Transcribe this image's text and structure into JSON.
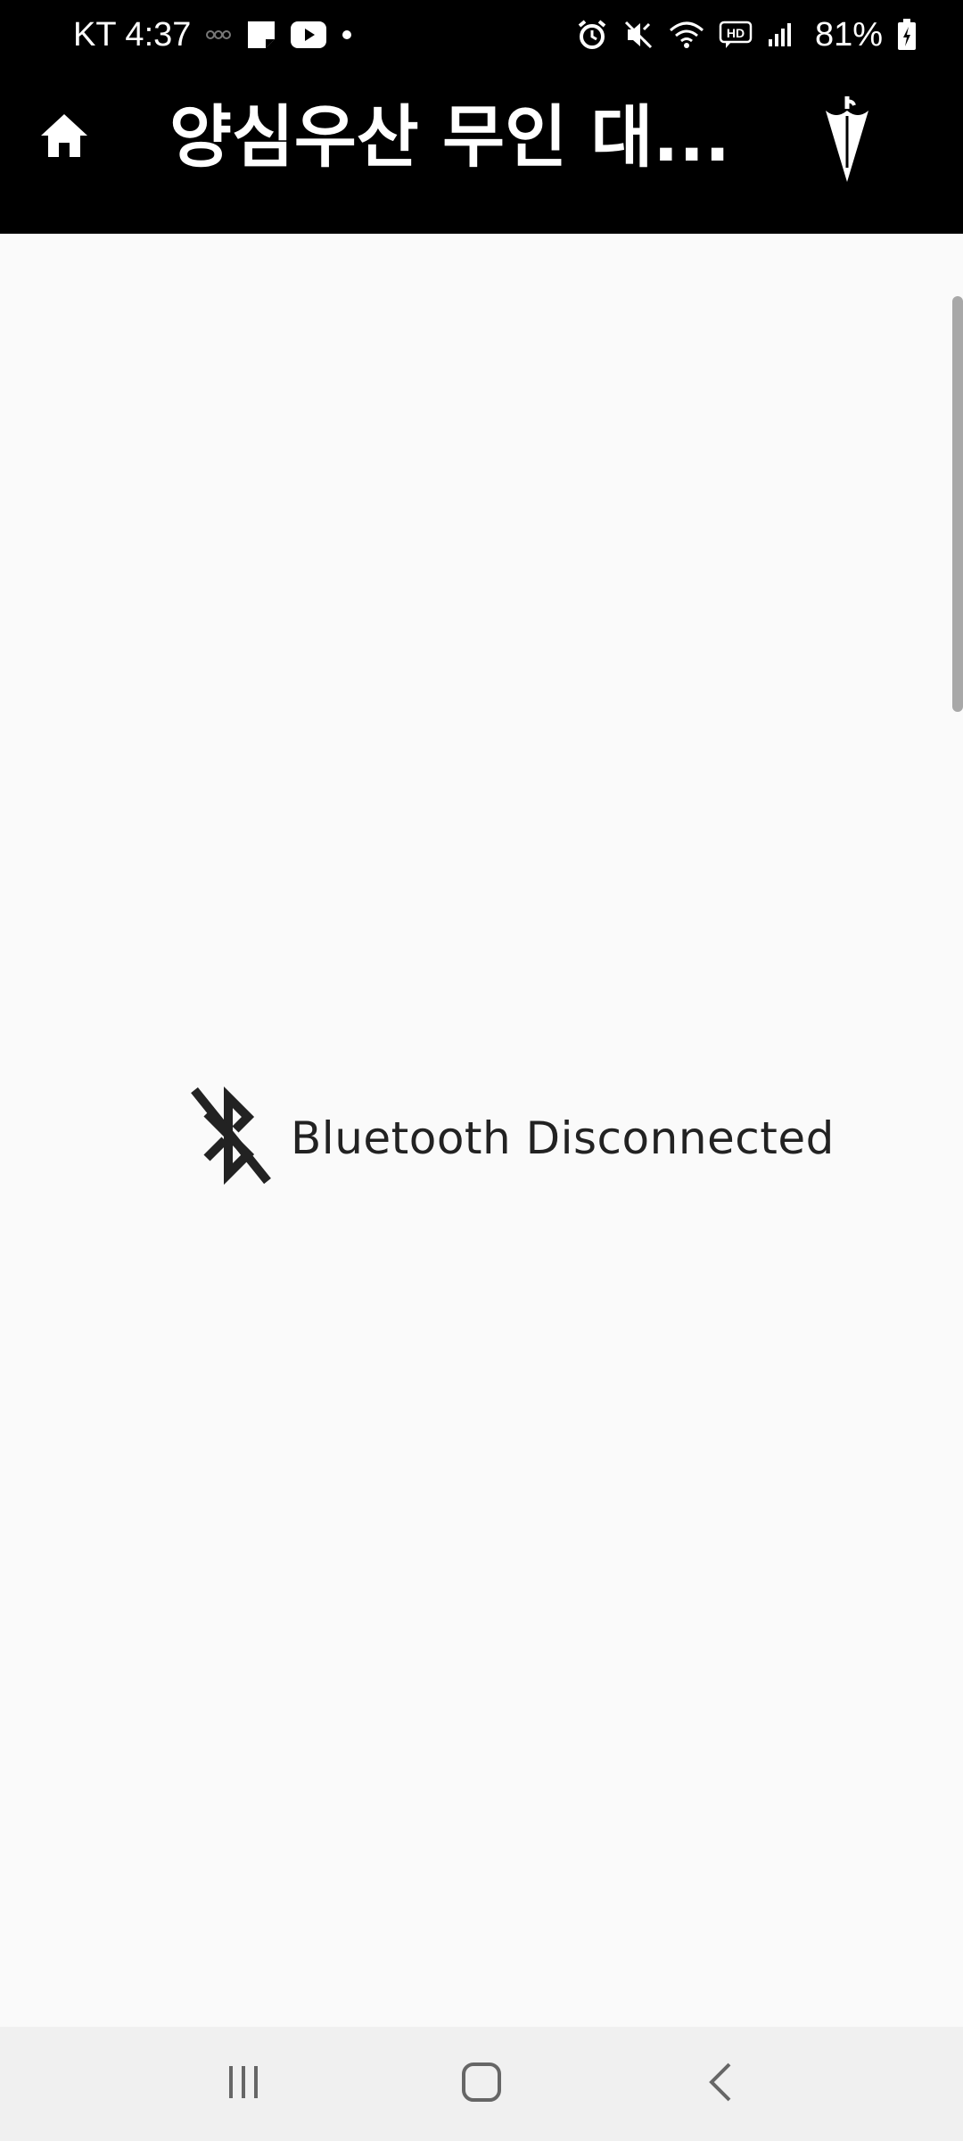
{
  "status_bar": {
    "carrier_time": "KT 4:37",
    "battery": "81%",
    "left_icons": [
      "call-record-icon",
      "note-icon",
      "youtube-icon",
      "dot-icon"
    ],
    "right_icons": [
      "alarm-icon",
      "mute-icon",
      "wifi-icon",
      "hd-voice-icon",
      "signal-icon",
      "battery-charging-icon"
    ]
  },
  "app_bar": {
    "title": "양심우산 무인 대...",
    "home_icon": "home-icon",
    "action_icon": "umbrella-icon"
  },
  "main": {
    "bluetooth_icon": "bluetooth-disabled-icon",
    "bluetooth_status": "Bluetooth Disconnected"
  },
  "nav_bar": {
    "buttons": [
      "recent-apps-icon",
      "home-nav-icon",
      "back-icon"
    ]
  },
  "colors": {
    "app_bar_bg": "#000000",
    "content_bg": "#fafafa",
    "text_dark": "#222222",
    "nav_bg": "#f0f0f0"
  }
}
